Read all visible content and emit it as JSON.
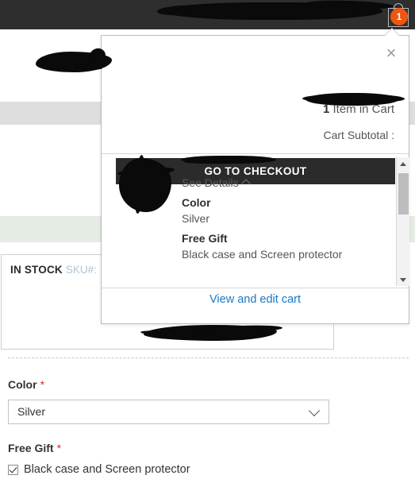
{
  "topbar": {
    "redacted_nav": "",
    "cart_icon": "shopping-bag-icon",
    "cart_count": "1"
  },
  "logo": {
    "redacted": ""
  },
  "minicart": {
    "close_icon": "×",
    "item_count_number": "1",
    "item_count_text": " Item in Cart",
    "subtotal_label": "Cart Subtotal :",
    "subtotal_value_redacted": "",
    "checkout_button": "GO TO CHECKOUT",
    "product_name_redacted": "",
    "see_details_label": "See Details",
    "see_details_chevron": "chevron-up-icon",
    "options": [
      {
        "name": "Color",
        "value": "Silver"
      },
      {
        "name": "Free Gift",
        "value": "Black case and Screen protector"
      }
    ],
    "view_cart_link": "View and edit cart",
    "scrollbar": {
      "up_arrow": "scroll-up-arrow",
      "down_arrow": "scroll-down-arrow"
    }
  },
  "product": {
    "stock_status": "IN STOCK",
    "sku_label": "SKU#:"
  },
  "form": {
    "color": {
      "label": "Color",
      "required_mark": "*",
      "selected_value": "Silver"
    },
    "free_gift": {
      "label": "Free Gift",
      "required_mark": "*",
      "option_label": "Black case and Screen protector",
      "checked": true
    }
  },
  "colors": {
    "topbar_bg": "#2e2e2e",
    "badge_orange": "#ef5611",
    "checkout_btn": "#2b2b2b",
    "link_blue": "#1979c3",
    "required_red": "#e02b27",
    "sku_gray": "#adc6d6",
    "green_band": "#e4ece3",
    "gray_band": "#dedede"
  }
}
